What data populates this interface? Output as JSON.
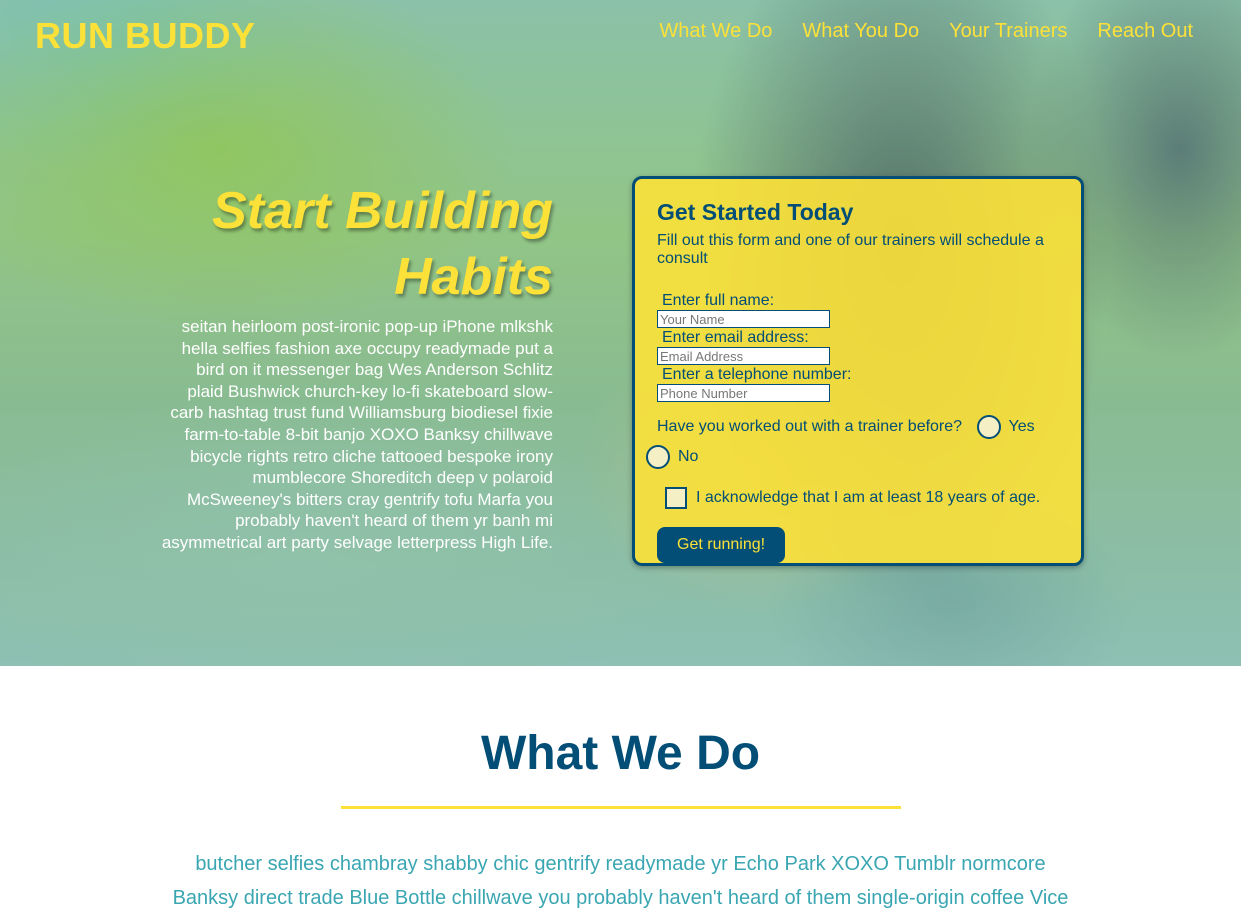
{
  "header": {
    "brand": "RUN BUDDY",
    "nav": [
      "What We Do",
      "What You Do",
      "Your Trainers",
      "Reach Out"
    ]
  },
  "intro": {
    "title": "Start Building Habits",
    "body": "seitan heirloom post-ironic pop-up iPhone mlkshk hella selfies fashion axe occupy readymade put a bird on it messenger bag Wes Anderson Schlitz plaid Bushwick church-key lo-fi skateboard slow-carb hashtag trust fund Williamsburg biodiesel fixie farm-to-table 8-bit banjo XOXO Banksy chillwave bicycle rights retro cliche tattooed bespoke irony mumblecore Shoreditch deep v polaroid McSweeney's bitters cray gentrify tofu Marfa you probably haven't heard of them yr banh mi asymmetrical art party selvage letterpress High Life."
  },
  "form": {
    "title": "Get Started Today",
    "lead": "Fill out this form and one of our trainers will schedule a consult",
    "name_label": "Enter full name:",
    "name_placeholder": "Your Name",
    "email_label": "Enter email address:",
    "email_placeholder": "Email Address",
    "phone_label": "Enter a telephone number:",
    "phone_placeholder": "Phone Number",
    "trainer_question": "Have you worked out with a trainer before?",
    "yes_label": "Yes",
    "no_label": "No",
    "age_ack": "I acknowledge that I am at least 18 years of age.",
    "submit_label": "Get running!"
  },
  "what_we_do": {
    "title": "What We Do",
    "body": "butcher selfies chambray shabby chic gentrify readymade yr Echo Park XOXO Tumblr normcore Banksy direct trade Blue Bottle chillwave you probably haven't heard of them single-origin coffee Vice"
  },
  "colors": {
    "primary": "#024e76",
    "accent": "#fce138",
    "teal": "#39a6b2"
  }
}
